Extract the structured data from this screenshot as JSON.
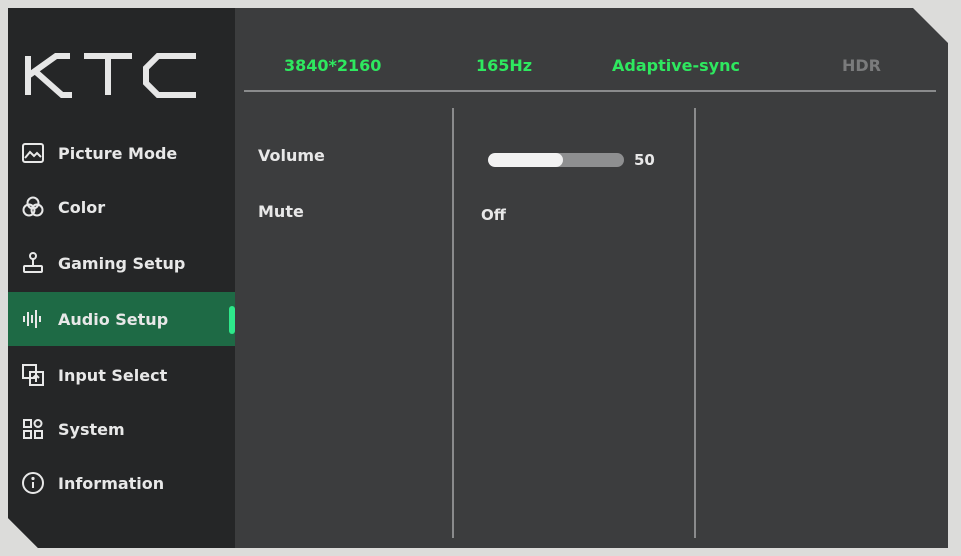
{
  "brand": {
    "logo_text": "KTC",
    "accent": "#2ee85f",
    "active_bg": "#1e6a45"
  },
  "status": {
    "resolution": "3840*2160",
    "refresh": "165Hz",
    "sync": "Adaptive-sync",
    "hdr": "HDR"
  },
  "menu": {
    "items": [
      {
        "label": "Picture Mode",
        "icon": "picture-icon"
      },
      {
        "label": "Color",
        "icon": "color-circles-icon"
      },
      {
        "label": "Gaming Setup",
        "icon": "joystick-icon"
      },
      {
        "label": "Audio Setup",
        "icon": "audio-wave-icon",
        "active": true
      },
      {
        "label": "Input Select",
        "icon": "input-icon"
      },
      {
        "label": "System",
        "icon": "system-grid-icon"
      },
      {
        "label": "Information",
        "icon": "info-icon"
      }
    ]
  },
  "settings": {
    "volume_label": "Volume",
    "volume_value": "50",
    "volume_level": 0.55,
    "mute_label": "Mute",
    "mute_value": "Off"
  }
}
